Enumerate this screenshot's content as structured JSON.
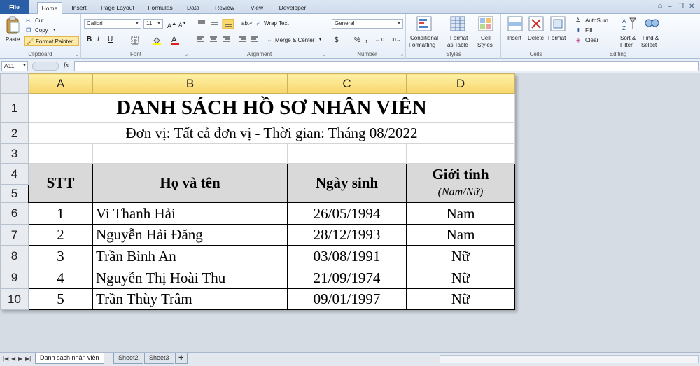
{
  "tabs": [
    "File",
    "Home",
    "Insert",
    "Page Layout",
    "Formulas",
    "Data",
    "Review",
    "View",
    "Developer"
  ],
  "ribbon": {
    "clipboard": {
      "paste": "Paste",
      "cut": "Cut",
      "copy": "Copy",
      "format_painter": "Format Painter",
      "label": "Clipboard"
    },
    "font": {
      "font_name": "Calibri",
      "font_size": "11",
      "bold": "B",
      "italic": "I",
      "underline": "U",
      "label": "Font"
    },
    "alignment": {
      "wrap_text": "Wrap Text",
      "merge_center": "Merge & Center",
      "label": "Alignment"
    },
    "number": {
      "format": "General",
      "currency": "$",
      "percent": "%",
      "comma": ",",
      "label": "Number"
    },
    "styles": {
      "conditional": "Conditional",
      "conditional2": "Formatting",
      "format_table": "Format",
      "format_table2": "as Table",
      "cell_styles": "Cell",
      "cell_styles2": "Styles",
      "label": "Styles"
    },
    "cells": {
      "insert": "Insert",
      "delete": "Delete",
      "format": "Format",
      "label": "Cells"
    },
    "editing": {
      "autosum": "AutoSum",
      "fill": "Fill",
      "clear": "Clear",
      "sort": "Sort &",
      "sort2": "Filter",
      "find": "Find &",
      "find2": "Select",
      "label": "Editing"
    }
  },
  "formula_bar": {
    "name_box": "A11",
    "fx": "fx",
    "value": ""
  },
  "columns": [
    "A",
    "B",
    "C",
    "D"
  ],
  "rows": [
    "1",
    "2",
    "3",
    "4",
    "5",
    "6",
    "7",
    "8",
    "9",
    "10"
  ],
  "sheet": {
    "title": "DANH SÁCH HỒ SƠ NHÂN VIÊN",
    "subtitle": "Đơn vị: Tất cả đơn vị - Thời gian: Tháng 08/2022",
    "headers": {
      "stt": "STT",
      "name": "Họ và tên",
      "dob": "Ngày sinh",
      "gender": "Giới tính",
      "gender_sub": "(Nam/Nữ)"
    },
    "records": [
      {
        "stt": "1",
        "name": "Vi Thanh Hải",
        "dob": "26/05/1994",
        "gender": "Nam"
      },
      {
        "stt": "2",
        "name": "Nguyễn Hải Đăng",
        "dob": "28/12/1993",
        "gender": "Nam"
      },
      {
        "stt": "3",
        "name": "Trần Bình An",
        "dob": "03/08/1991",
        "gender": "Nữ"
      },
      {
        "stt": "4",
        "name": "Nguyễn Thị Hoài Thu",
        "dob": "21/09/1974",
        "gender": "Nữ"
      },
      {
        "stt": "5",
        "name": "Trần Thùy Trâm",
        "dob": "09/01/1997",
        "gender": "Nữ"
      }
    ]
  },
  "sheet_tabs": [
    "Danh sách nhân viên",
    "Sheet2",
    "Sheet3"
  ],
  "colors": {
    "file_tab": "#2a5fa8",
    "selected_col_header": "#f7d66b",
    "table_header_fill": "#d9d9d9"
  }
}
